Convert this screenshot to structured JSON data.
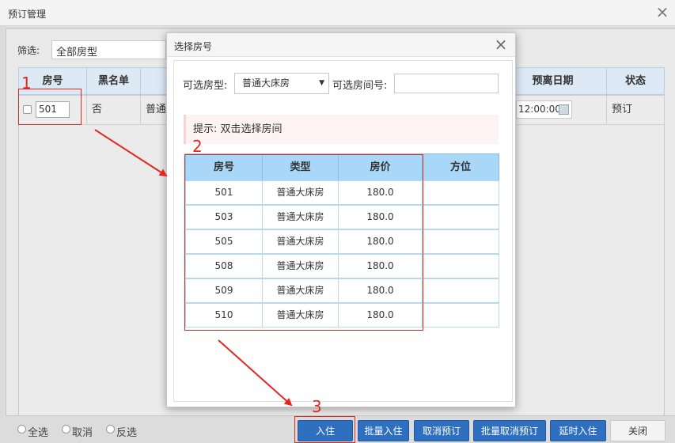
{
  "outer": {
    "title": "预订管理",
    "close": "×",
    "filter_label": "筛选:",
    "filter_value": "全部房型",
    "headers": {
      "room": "房号",
      "blacklist": "黑名单",
      "leave_date": "预离日期",
      "status": "状态"
    },
    "row": {
      "room": "501",
      "blacklist": "否",
      "type_partial": "普通",
      "leave_time": "12:00:00",
      "status": "预订"
    },
    "radios": [
      "全选",
      "取消",
      "反选"
    ],
    "buttons": {
      "checkin": "入住",
      "batch_checkin": "批量入住",
      "cancel_booking": "取消预订",
      "batch_cancel": "批量取消预订",
      "delay_checkin": "延时入住",
      "close": "关闭"
    }
  },
  "modal": {
    "title": "选择房号",
    "close": "×",
    "room_type_label": "可选房型:",
    "room_type_value": "普通大床房",
    "room_no_label": "可选房间号:",
    "hint": "提示: 双击选择房间",
    "headers": {
      "room": "房号",
      "type": "类型",
      "price": "房价",
      "direction": "方位"
    },
    "rows": [
      {
        "room": "501",
        "type": "普通大床房",
        "price": "180.0",
        "direction": ""
      },
      {
        "room": "503",
        "type": "普通大床房",
        "price": "180.0",
        "direction": ""
      },
      {
        "room": "505",
        "type": "普通大床房",
        "price": "180.0",
        "direction": ""
      },
      {
        "room": "508",
        "type": "普通大床房",
        "price": "180.0",
        "direction": ""
      },
      {
        "room": "509",
        "type": "普通大床房",
        "price": "180.0",
        "direction": ""
      },
      {
        "room": "510",
        "type": "普通大床房",
        "price": "180.0",
        "direction": ""
      }
    ]
  },
  "annotations": {
    "one": "1",
    "two": "2",
    "three": "3"
  },
  "colors": {
    "primary_button": "#2f6fbf",
    "annotation_red": "#e1281f",
    "inner_header": "#a9d7f7"
  }
}
